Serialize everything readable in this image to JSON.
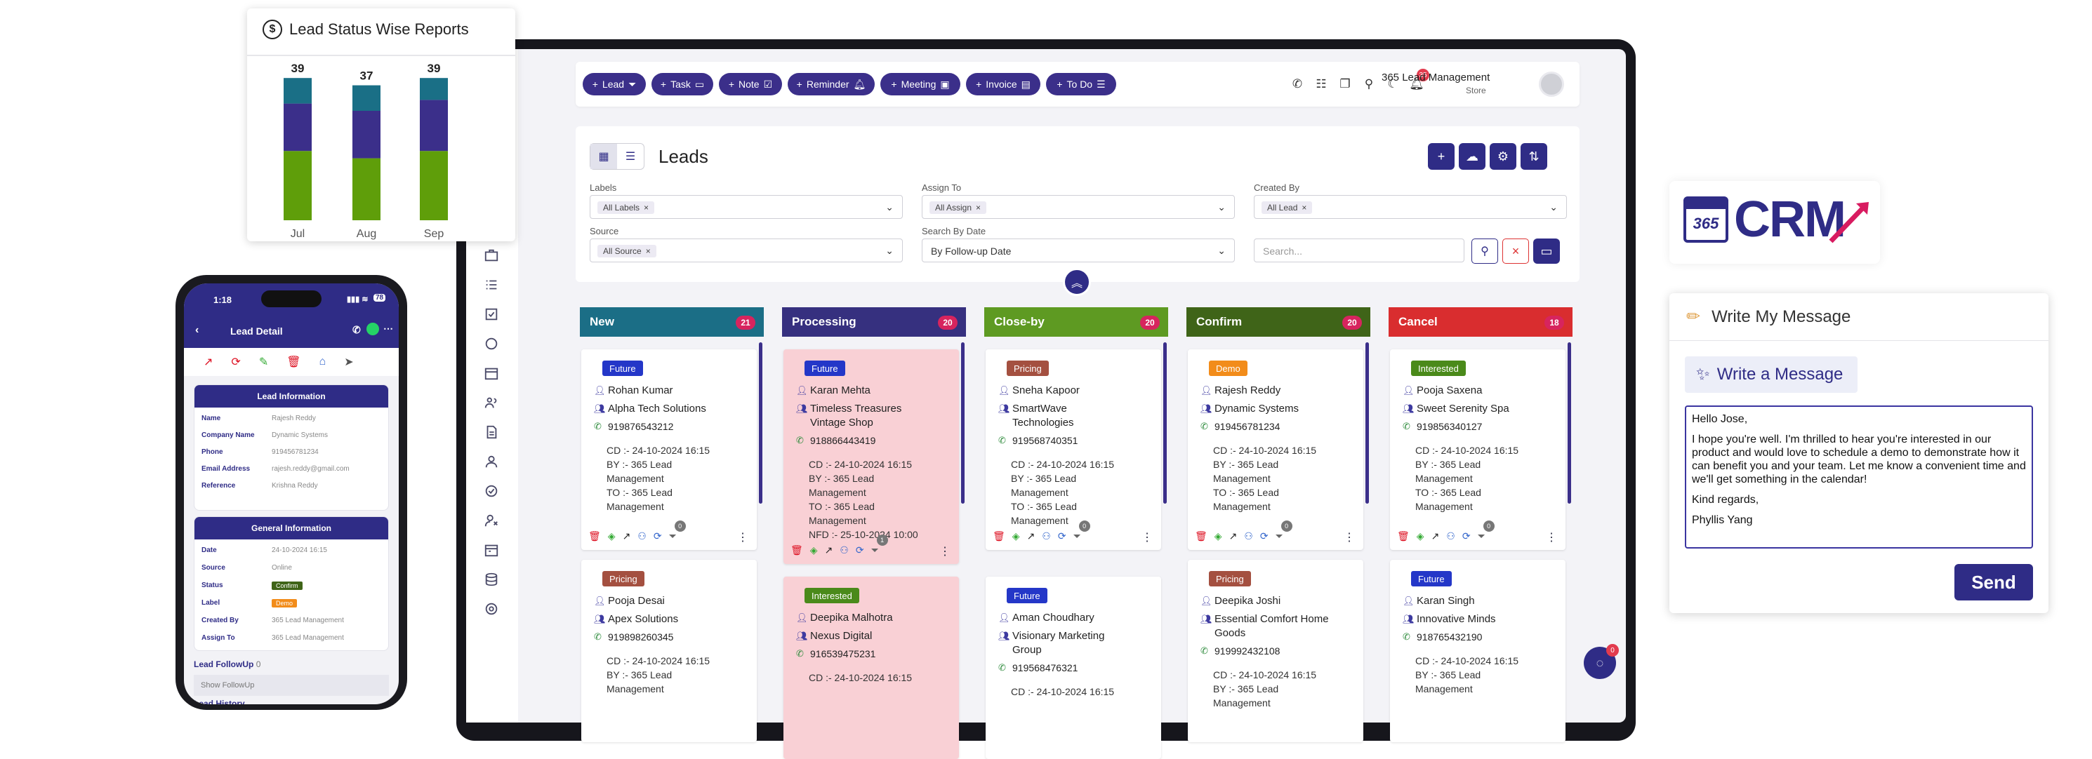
{
  "chart": {
    "title": "Lead Status Wise Reports",
    "icon": "dollar-circle-icon",
    "chart_data": {
      "type": "bar",
      "stacked": true,
      "categories": [
        "Jul",
        "Aug",
        "Sep"
      ],
      "totals": [
        39,
        37,
        39
      ],
      "series": [
        {
          "color": "#5f9e0a",
          "values": [
            19,
            17,
            19
          ]
        },
        {
          "color": "#3b2f8a",
          "values": [
            13,
            13,
            14
          ]
        },
        {
          "color": "#1a6f86",
          "values": [
            7,
            7,
            6
          ]
        }
      ],
      "title": "Lead Status Wise Reports",
      "grid": false
    }
  },
  "toolbar": {
    "buttons": [
      {
        "label": "Lead",
        "icon": "filter-icon"
      },
      {
        "label": "Task",
        "icon": "calendar-icon"
      },
      {
        "label": "Note",
        "icon": "checkbox-icon"
      },
      {
        "label": "Reminder",
        "icon": "bell-icon"
      },
      {
        "label": "Meeting",
        "icon": "briefcase-icon"
      },
      {
        "label": "Invoice",
        "icon": "document-icon"
      },
      {
        "label": "To Do",
        "icon": "list-icon"
      }
    ],
    "notif_count": "35",
    "company": "365 Lead Management",
    "store": "Store"
  },
  "leads": {
    "title": "Leads",
    "labels_label": "Labels",
    "labels_chip": "All Labels",
    "assign_label": "Assign To",
    "assign_chip": "All Assign",
    "created_label": "Created By",
    "created_chip": "All Lead",
    "source_label": "Source",
    "source_chip": "All Source",
    "search_date_label": "Search By Date",
    "search_date_value": "By Follow-up Date",
    "search_placeholder": "Search..."
  },
  "columns": [
    {
      "name": "New",
      "count": "21",
      "color": "#1b6e86"
    },
    {
      "name": "Processing",
      "count": "20",
      "color": "#36307f"
    },
    {
      "name": "Close-by",
      "count": "20",
      "color": "#5e9a22"
    },
    {
      "name": "Confirm",
      "count": "20",
      "color": "#3f6418"
    },
    {
      "name": "Cancel",
      "count": "18",
      "color": "#d92d2f"
    }
  ],
  "cards": {
    "new1": {
      "tag": "Future",
      "name": "Rohan Kumar",
      "company": "Alpha Tech Solutions",
      "phone": "919876543212",
      "cd": "CD :- 24-10-2024 16:15",
      "by": "BY :- 365 Lead",
      "by2": "Management",
      "to": "TO :- 365 Lead",
      "to2": "Management",
      "badge": "0"
    },
    "new2": {
      "tag": "Pricing",
      "name": "Pooja Desai",
      "company": "Apex Solutions",
      "phone": "919898260345",
      "cd": "CD :- 24-10-2024 16:15",
      "by": "BY :- 365 Lead",
      "by2": "Management"
    },
    "proc1": {
      "tag": "Future",
      "name": "Karan Mehta",
      "company": "Timeless Treasures",
      "company2": "Vintage Shop",
      "phone": "918866443419",
      "cd": "CD :- 24-10-2024 16:15",
      "by": "BY :- 365 Lead",
      "by2": "Management",
      "to": "TO :- 365 Lead",
      "to2": "Management",
      "nfd": "NFD :- 25-10-2024 10:00",
      "badge": "1"
    },
    "proc2": {
      "tag": "Interested",
      "name": "Deepika Malhotra",
      "company": "Nexus Digital",
      "phone": "916539475231",
      "cd": "CD :- 24-10-2024 16:15"
    },
    "close1": {
      "tag": "Pricing",
      "name": "Sneha Kapoor",
      "company": "SmartWave",
      "company2": "Technologies",
      "phone": "919568740351",
      "cd": "CD :- 24-10-2024 16:15",
      "by": "BY :- 365 Lead",
      "by2": "Management",
      "to": "TO :- 365 Lead",
      "to2": "Management",
      "badge": "0"
    },
    "close2": {
      "tag": "Future",
      "name": "Aman Choudhary",
      "company": "Visionary Marketing",
      "company2": "Group",
      "phone": "919568476321",
      "cd": "CD :- 24-10-2024 16:15"
    },
    "conf1": {
      "tag": "Demo",
      "name": "Rajesh Reddy",
      "company": "Dynamic Systems",
      "phone": "919456781234",
      "cd": "CD :- 24-10-2024 16:15",
      "by": "BY :- 365 Lead",
      "by2": "Management",
      "to": "TO :- 365 Lead",
      "to2": "Management",
      "badge": "0"
    },
    "conf2": {
      "tag": "Pricing",
      "name": "Deepika Joshi",
      "company": "Essential Comfort Home",
      "company2": "Goods",
      "phone": "919992432108",
      "cd": "CD :- 24-10-2024 16:15",
      "by": "BY :- 365 Lead",
      "by2": "Management"
    },
    "canc1": {
      "tag": "Interested",
      "name": "Pooja Saxena",
      "company": "Sweet Serenity Spa",
      "phone": "919856340127",
      "cd": "CD :- 24-10-2024 16:15",
      "by": "BY :- 365 Lead",
      "by2": "Management",
      "to": "TO :- 365 Lead",
      "to2": "Management",
      "badge": "0"
    },
    "canc2": {
      "tag": "Future",
      "name": "Karan Singh",
      "company": "Innovative Minds",
      "phone": "918765432190",
      "cd": "CD :- 24-10-2024 16:15",
      "by": "BY :- 365 Lead",
      "by2": "Management"
    }
  },
  "chat_badge": "0",
  "logo": {
    "prefix": "365",
    "text": "CRM"
  },
  "message": {
    "header": "Write My Message",
    "button": "Write a Message",
    "greeting": "Hello Jose,",
    "body": "I hope you're well. I'm thrilled to hear you're interested in our product and would love to schedule a demo to demonstrate how it can benefit you and your team. Let me know a convenient time and we'll get something in the calendar!",
    "closing": "Kind regards,",
    "signature": "Phyllis Yang",
    "send": "Send"
  },
  "phone": {
    "time": "1:18",
    "battery": "78",
    "title": "Lead Detail",
    "lead_info_title": "Lead Information",
    "lead_info": [
      {
        "k": "Name",
        "v": "Rajesh Reddy"
      },
      {
        "k": "Company Name",
        "v": "Dynamic Systems"
      },
      {
        "k": "Phone",
        "v": "919456781234"
      },
      {
        "k": "Email Address",
        "v": "rajesh.reddy@gmail.com"
      },
      {
        "k": "Reference",
        "v": "Krishna Reddy"
      }
    ],
    "general_title": "General Information",
    "general": [
      {
        "k": "Date",
        "v": "24-10-2024 16:15"
      },
      {
        "k": "Source",
        "v": "Online"
      },
      {
        "k": "Status",
        "v": "Confirm"
      },
      {
        "k": "Label",
        "v": "Demo"
      },
      {
        "k": "Created By",
        "v": "365 Lead Management"
      },
      {
        "k": "Assign To",
        "v": "365 Lead Management"
      }
    ],
    "followup_label": "Lead FollowUp",
    "followup_count": "0",
    "show_followup": "Show FollowUp",
    "history": "Lead History"
  }
}
